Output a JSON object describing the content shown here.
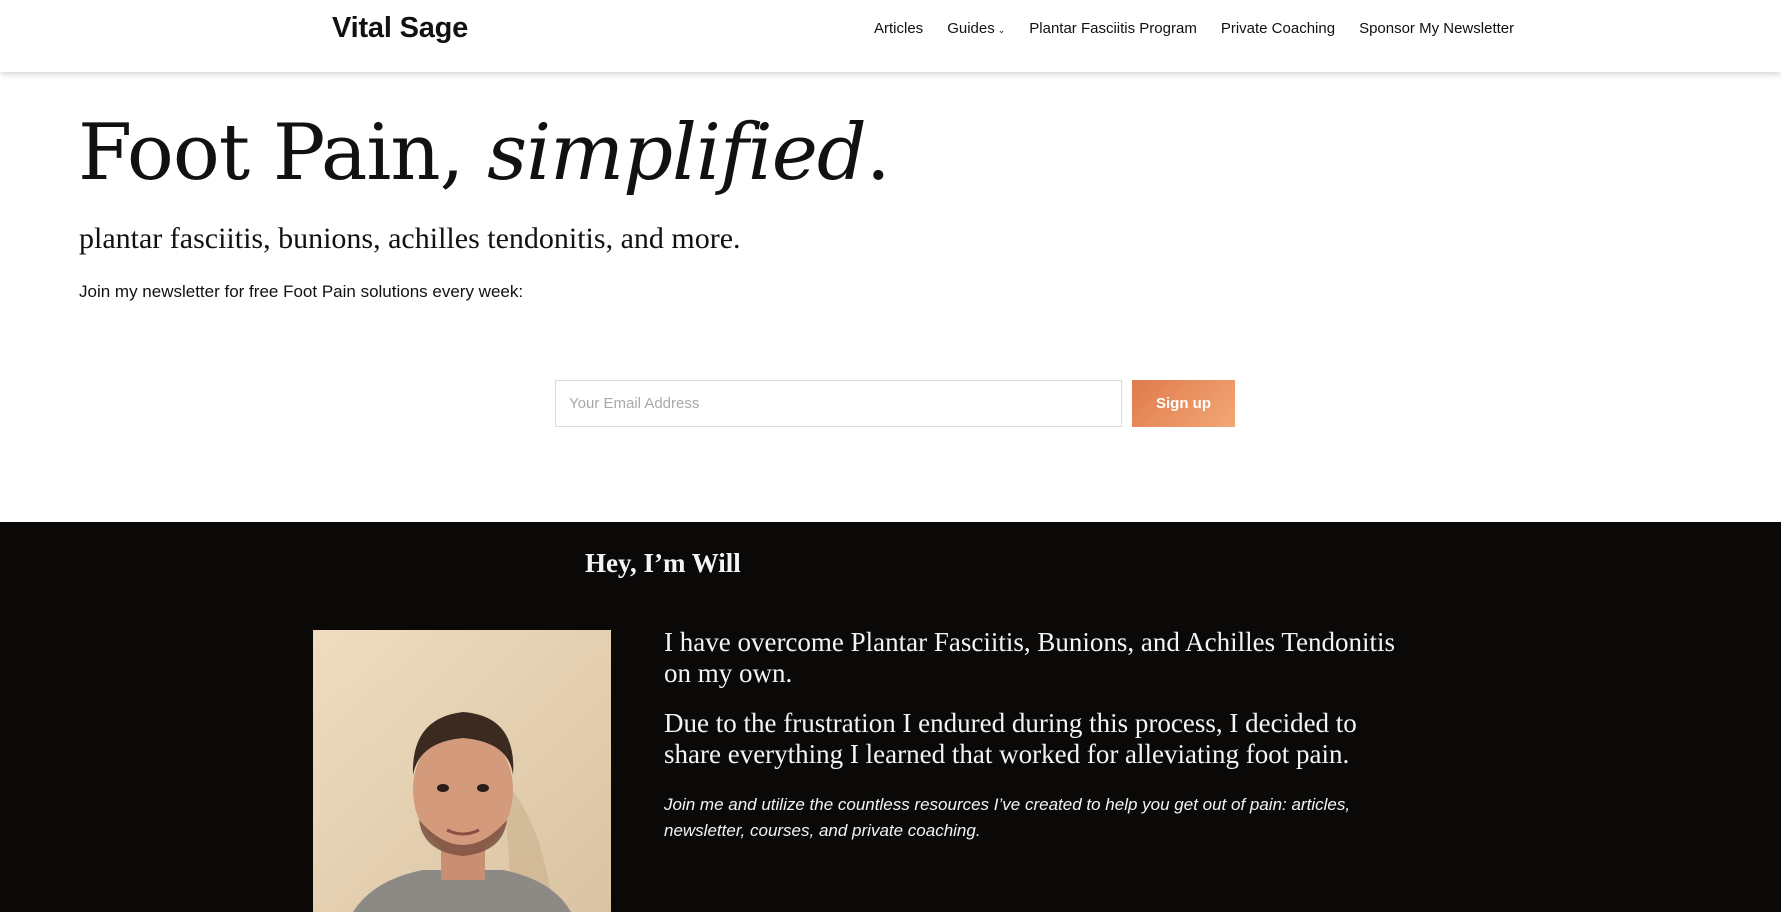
{
  "header": {
    "logo": "Vital Sage",
    "nav": [
      {
        "label": "Articles"
      },
      {
        "label": "Guides",
        "has_dropdown": true
      },
      {
        "label": "Plantar Fasciitis Program"
      },
      {
        "label": "Private Coaching"
      },
      {
        "label": "Sponsor My Newsletter"
      }
    ]
  },
  "hero": {
    "title_plain": "Foot Pain, ",
    "title_italic": "simplified",
    "title_end": ".",
    "subtitle": "plantar fasciitis, bunions, achilles tendonitis, and more.",
    "note": "Join my newsletter for free Foot Pain solutions every week:"
  },
  "signup": {
    "email_placeholder": "Your Email Address",
    "button_label": "Sign up",
    "button_color": "#e98a5c"
  },
  "about": {
    "heading": "Hey, I’m Will",
    "paragraph1": "I have overcome Plantar Fasciitis, Bunions, and Achilles Tendonitis on my own.",
    "paragraph2": "Due to the frustration I endured during this process, I decided to share everything I learned that worked for alleviating foot pain.",
    "paragraph3": "Join me and utilize the countless resources I’ve created to help you get out of pain: articles, newsletter, courses, and private coaching.",
    "background_color": "#0a0908"
  }
}
